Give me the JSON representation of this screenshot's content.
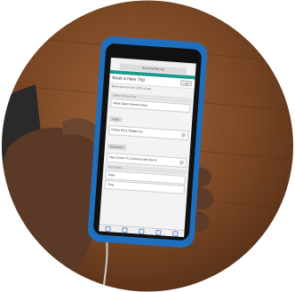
{
  "status": {
    "carrier": "",
    "time": "",
    "battery": ""
  },
  "browser": {
    "url": "book.chartnet.org"
  },
  "app": {
    "title": "Book a New Trip",
    "login_label": "Login"
  },
  "intro_text": "Book trips from Nov. 2019 or later.",
  "form": {
    "service_label": "Select Service Area",
    "service_value": "West Salem Service Area",
    "origin_label": "Origin",
    "origin_value": "Perley Rd & Teddler Ru",
    "destination_label": "Destination",
    "destination_value": "New Creek TC (Connect with the bl",
    "trip_details_label": "Trip Details",
    "date_label": "Date",
    "time_label": "Time"
  },
  "colors": {
    "accent": "#1d9a8c",
    "case": "#1f6fbf",
    "floor": "#6b3f20"
  }
}
